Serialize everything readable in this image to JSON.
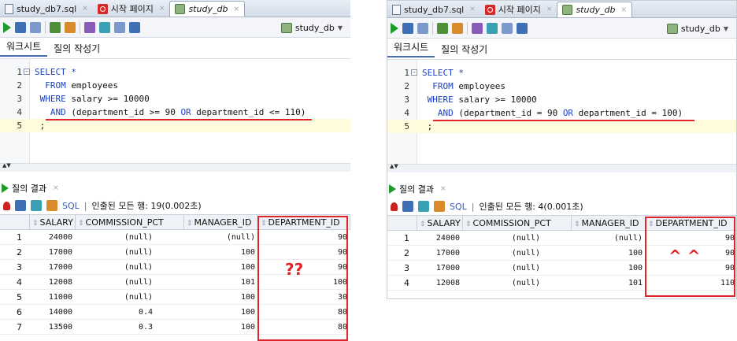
{
  "left": {
    "tabs": [
      {
        "label": "study_db7.sql",
        "icon": "sql-file-icon"
      },
      {
        "label": "시작 페이지",
        "icon": "start-page-icon"
      },
      {
        "label": "study_db",
        "icon": "database-icon",
        "active": true
      }
    ],
    "connection": "study_db",
    "subtabs": [
      "워크시트",
      "질의 작성기"
    ],
    "editor_lines": [
      {
        "n": "1",
        "fold": true,
        "parts": [
          {
            "t": "SELECT ",
            "k": "kw"
          },
          {
            "t": "*",
            "k": "kw"
          }
        ]
      },
      {
        "n": "2",
        "parts": [
          {
            "t": "  FROM ",
            "k": "kw"
          },
          {
            "t": "employees",
            "k": ""
          }
        ]
      },
      {
        "n": "3",
        "parts": [
          {
            "t": " WHERE ",
            "k": "kw"
          },
          {
            "t": "salary >= 10000",
            "k": ""
          }
        ]
      },
      {
        "n": "4",
        "parts": [
          {
            "t": "   AND ",
            "k": "kw"
          },
          {
            "t": "(department_id >= 90 ",
            "k": ""
          },
          {
            "t": "OR",
            "k": "kw"
          },
          {
            "t": " department_id <= 110)",
            "k": ""
          }
        ]
      },
      {
        "n": "5",
        "parts": [
          {
            "t": " ;",
            "k": ""
          }
        ],
        "current": true
      }
    ],
    "result_tab": "질의 결과",
    "toolbar_sql": "SQL",
    "status": "인출된 모든 행: 19(0.002초)",
    "columns": [
      "SALARY",
      "COMMISSION_PCT",
      "MANAGER_ID",
      "DEPARTMENT_ID"
    ],
    "rows": [
      [
        "1",
        "24000",
        "(null)",
        "(null)",
        "90"
      ],
      [
        "2",
        "17000",
        "(null)",
        "100",
        "90"
      ],
      [
        "3",
        "17000",
        "(null)",
        "100",
        "90"
      ],
      [
        "4",
        "12008",
        "(null)",
        "101",
        "100"
      ],
      [
        "5",
        "11000",
        "(null)",
        "100",
        "30"
      ],
      [
        "6",
        "14000",
        "0.4",
        "100",
        "80"
      ],
      [
        "7",
        "13500",
        "0.3",
        "100",
        "80"
      ]
    ],
    "annotation": "??"
  },
  "right": {
    "tabs": [
      {
        "label": "study_db7.sql",
        "icon": "sql-file-icon"
      },
      {
        "label": "시작 페이지",
        "icon": "start-page-icon"
      },
      {
        "label": "study_db",
        "icon": "database-icon",
        "active": true
      }
    ],
    "connection": "study_db",
    "subtabs": [
      "워크시트",
      "질의 작성기"
    ],
    "editor_lines": [
      {
        "n": "1",
        "fold": true,
        "parts": [
          {
            "t": "SELECT ",
            "k": "kw"
          },
          {
            "t": "*",
            "k": "kw"
          }
        ]
      },
      {
        "n": "2",
        "parts": [
          {
            "t": "  FROM ",
            "k": "kw"
          },
          {
            "t": "employees",
            "k": ""
          }
        ]
      },
      {
        "n": "3",
        "parts": [
          {
            "t": " WHERE ",
            "k": "kw"
          },
          {
            "t": "salary >= 10000",
            "k": ""
          }
        ]
      },
      {
        "n": "4",
        "parts": [
          {
            "t": "   AND ",
            "k": "kw"
          },
          {
            "t": "(department_id = 90 ",
            "k": ""
          },
          {
            "t": "OR",
            "k": "kw"
          },
          {
            "t": " department_id = 100)",
            "k": ""
          }
        ]
      },
      {
        "n": "5",
        "parts": [
          {
            "t": " ;",
            "k": ""
          }
        ],
        "current": true
      }
    ],
    "result_tab": "질의 결과",
    "toolbar_sql": "SQL",
    "status": "인출된 모든 행: 4(0.001초)",
    "columns": [
      "SALARY",
      "COMMISSION_PCT",
      "MANAGER_ID",
      "DEPARTMENT_ID"
    ],
    "rows": [
      [
        "1",
        "24000",
        "(null)",
        "(null)",
        "90"
      ],
      [
        "2",
        "17000",
        "(null)",
        "100",
        "90"
      ],
      [
        "3",
        "17000",
        "(null)",
        "100",
        "90"
      ],
      [
        "4",
        "12008",
        "(null)",
        "101",
        "110"
      ]
    ],
    "annotation": "^ ^"
  },
  "colors": {
    "accent_red": "#e0242a",
    "keyword_blue": "#1a3fc6",
    "run_green": "#1f9b2c"
  }
}
